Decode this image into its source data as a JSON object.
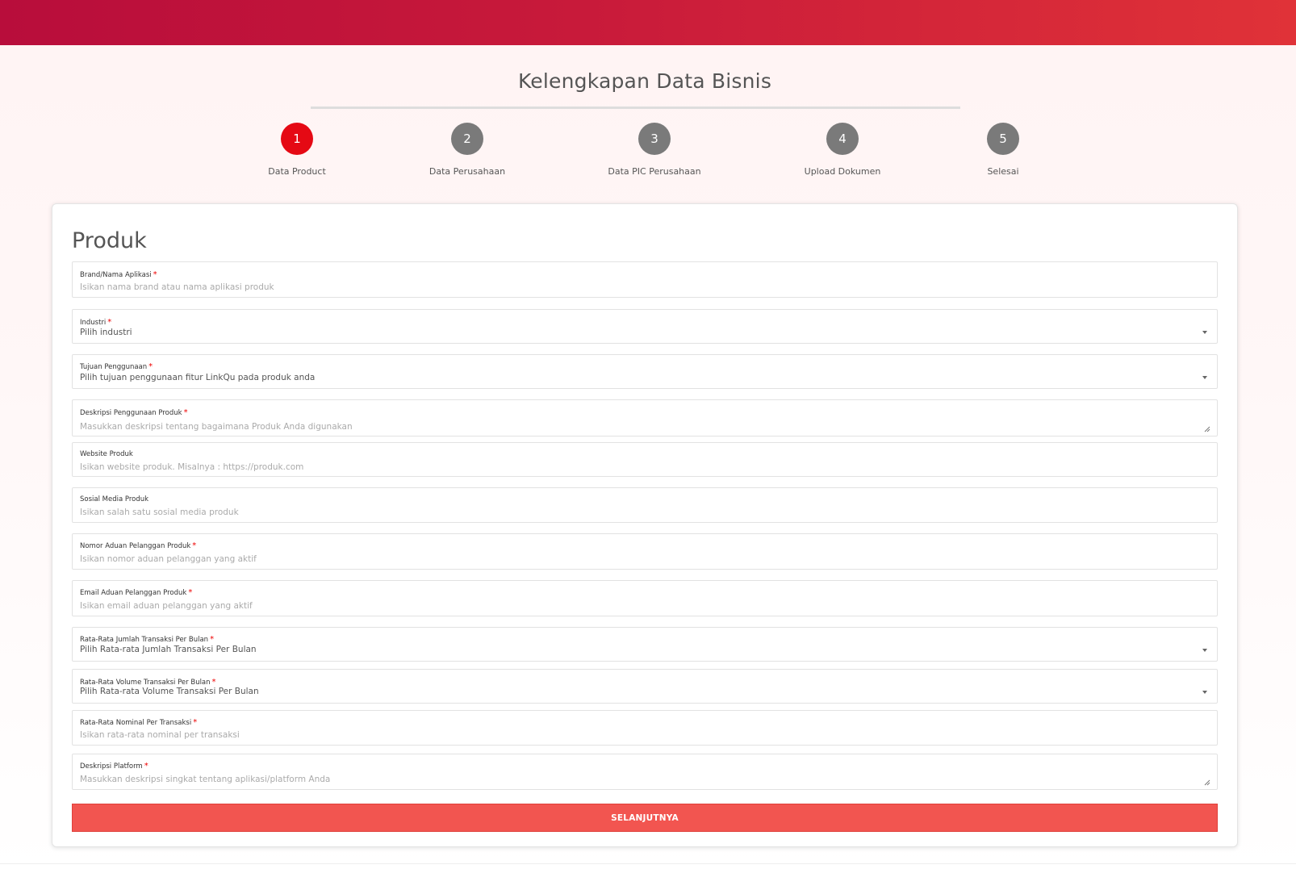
{
  "page": {
    "title": "Kelengkapan Data Bisnis"
  },
  "stepper": {
    "steps": [
      {
        "number": "1",
        "label": "Data Product",
        "active": true
      },
      {
        "number": "2",
        "label": "Data Perusahaan",
        "active": false
      },
      {
        "number": "3",
        "label": "Data PIC Perusahaan",
        "active": false
      },
      {
        "number": "4",
        "label": "Upload Dokumen",
        "active": false
      },
      {
        "number": "5",
        "label": "Selesai",
        "active": false
      }
    ]
  },
  "form": {
    "title": "Produk",
    "required_mark": "*",
    "fields": [
      {
        "label": "Brand/Nama Aplikasi",
        "required": true,
        "type": "text",
        "placeholder": "Isikan nama brand atau nama aplikasi produk"
      },
      {
        "label": "Industri",
        "required": true,
        "type": "select",
        "value": "Pilih industri"
      },
      {
        "label": "Tujuan Penggunaan",
        "required": true,
        "type": "select",
        "value": "Pilih tujuan penggunaan fitur LinkQu pada produk anda"
      },
      {
        "label": "Deskripsi Penggunaan Produk",
        "required": true,
        "type": "textarea",
        "placeholder": "Masukkan deskripsi tentang bagaimana Produk Anda digunakan"
      },
      {
        "label": "Website Produk",
        "required": false,
        "type": "text",
        "placeholder": "Isikan website produk. Misalnya : https://produk.com"
      },
      {
        "label": "Sosial Media Produk",
        "required": false,
        "type": "text",
        "placeholder": "Isikan salah satu sosial media produk"
      },
      {
        "label": "Nomor Aduan Pelanggan Produk",
        "required": true,
        "type": "text",
        "placeholder": "Isikan nomor aduan pelanggan yang aktif"
      },
      {
        "label": "Email Aduan Pelanggan Produk",
        "required": true,
        "type": "text",
        "placeholder": "Isikan email aduan pelanggan yang aktif"
      },
      {
        "label": "Rata-Rata Jumlah Transaksi Per Bulan",
        "required": true,
        "type": "select",
        "value": "Pilih Rata-rata Jumlah Transaksi Per Bulan"
      },
      {
        "label": "Rata-Rata Volume Transaksi Per Bulan",
        "required": true,
        "type": "select",
        "value": "Pilih Rata-rata Volume Transaksi Per Bulan"
      },
      {
        "label": "Rata-Rata Nominal Per Transaksi",
        "required": true,
        "type": "text",
        "placeholder": "Isikan rata-rata nominal per transaksi"
      },
      {
        "label": "Deskripsi Platform",
        "required": true,
        "type": "textarea",
        "placeholder": "Masukkan deskripsi singkat tentang aplikasi/platform Anda"
      }
    ],
    "submit_label": "SELANJUTNYA"
  },
  "colors": {
    "header_start": "#b80d3b",
    "header_end": "#e03238",
    "active_step": "#e50914",
    "inactive_step": "#7a7a7a",
    "button": "#f25550",
    "required": "#e00000"
  }
}
